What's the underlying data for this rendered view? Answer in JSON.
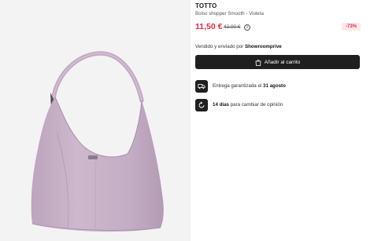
{
  "product": {
    "brand": "TOTTO",
    "name": "Bolso shopper Smooth - Violeta",
    "price": "11,50 €",
    "old_price": "42,00 €",
    "info_symbol": "i",
    "discount": "-73%"
  },
  "seller": {
    "prefix": "Vendido y enviado por",
    "name": "Showroomprive"
  },
  "cart": {
    "label": "Añadir al carrito"
  },
  "features": [
    {
      "text": "Entrega garantizada el",
      "highlight": "31 agosto",
      "icon": "truck-icon"
    },
    {
      "highlight": "14 días",
      "text": "para cambiar de opinión",
      "icon": "return-icon"
    }
  ],
  "colors": {
    "price": "#e8283f",
    "discount_bg": "#fde8ea",
    "button_bg": "#1f1f1f",
    "bag": "#c7b2c8"
  }
}
